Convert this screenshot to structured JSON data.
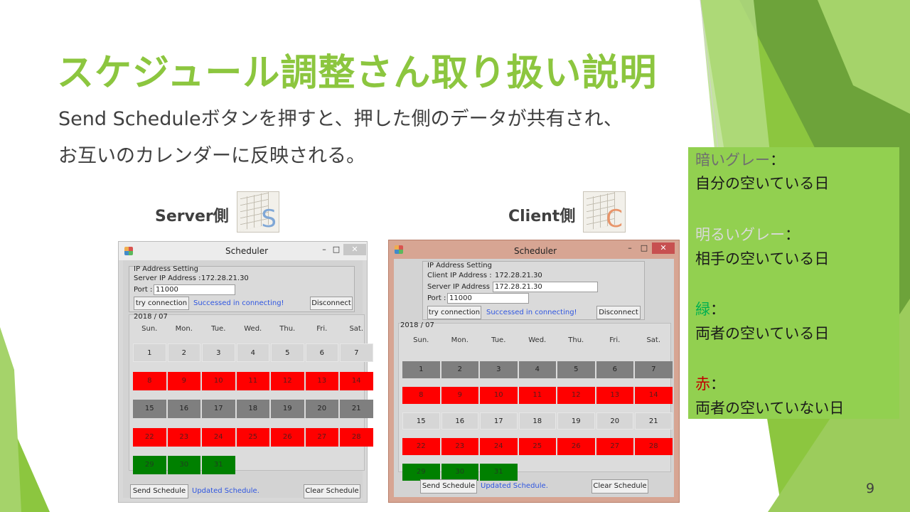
{
  "slide": {
    "title": "スケジュール調整さん取り扱い説明",
    "line1": "Send Scheduleボタンを押すと、押した側のデータが共有され、",
    "line2": "お互いのカレンダーに反映される。",
    "server_label": "Server側",
    "client_label": "Client側",
    "server_icon_letter": "S",
    "client_icon_letter": "C",
    "page_number": "9",
    "colors": {
      "accent": "#8cc63f",
      "legend_bg": "#92d050"
    }
  },
  "legend": [
    {
      "term": "暗いグレー",
      "term_color": "#7f7f7f",
      "sep": "：",
      "desc": "自分の空いている日"
    },
    {
      "term": "明るいグレー",
      "term_color": "#d9d9d9",
      "sep": "：",
      "desc": "相手の空いている日"
    },
    {
      "term": "緑",
      "term_color": "#00b050",
      "sep": "：",
      "desc": "両者の空いている日"
    },
    {
      "term": "赤",
      "term_color": "#c00000",
      "sep": "：",
      "desc": "両者の空いていない日"
    }
  ],
  "server_window": {
    "title": "Scheduler",
    "min": "–",
    "max": "□",
    "close": "✕",
    "ip_section": "IP Address Setting",
    "server_ip_label": "Server IP Address :",
    "server_ip_value": "172.28.21.30",
    "port_label": "Port :",
    "port_value": "11000",
    "try_button": "try connection",
    "connect_status": "Successed in connecting!",
    "disconnect_button": "Disconnect",
    "month": "2018 / 07",
    "weekdays": [
      "Sun.",
      "Mon.",
      "Tue.",
      "Wed.",
      "Thu.",
      "Fri.",
      "Sat."
    ],
    "weeks": [
      [
        {
          "d": "1",
          "s": "plain"
        },
        {
          "d": "2",
          "s": "plain"
        },
        {
          "d": "3",
          "s": "plain"
        },
        {
          "d": "4",
          "s": "plain"
        },
        {
          "d": "5",
          "s": "plain"
        },
        {
          "d": "6",
          "s": "plain"
        },
        {
          "d": "7",
          "s": "plain"
        }
      ],
      [
        {
          "d": "8",
          "s": "red"
        },
        {
          "d": "9",
          "s": "red"
        },
        {
          "d": "10",
          "s": "red"
        },
        {
          "d": "11",
          "s": "red"
        },
        {
          "d": "12",
          "s": "red"
        },
        {
          "d": "13",
          "s": "red"
        },
        {
          "d": "14",
          "s": "red"
        }
      ],
      [
        {
          "d": "15",
          "s": "gray"
        },
        {
          "d": "16",
          "s": "gray"
        },
        {
          "d": "17",
          "s": "gray"
        },
        {
          "d": "18",
          "s": "gray"
        },
        {
          "d": "19",
          "s": "gray"
        },
        {
          "d": "20",
          "s": "gray"
        },
        {
          "d": "21",
          "s": "gray"
        }
      ],
      [
        {
          "d": "22",
          "s": "red"
        },
        {
          "d": "23",
          "s": "red"
        },
        {
          "d": "24",
          "s": "red"
        },
        {
          "d": "25",
          "s": "red"
        },
        {
          "d": "26",
          "s": "red"
        },
        {
          "d": "27",
          "s": "red"
        },
        {
          "d": "28",
          "s": "red"
        }
      ],
      [
        {
          "d": "29",
          "s": "green"
        },
        {
          "d": "30",
          "s": "green"
        },
        {
          "d": "31",
          "s": "green"
        },
        {
          "d": "",
          "s": "empty"
        },
        {
          "d": "",
          "s": "empty"
        },
        {
          "d": "",
          "s": "empty"
        },
        {
          "d": "",
          "s": "empty"
        }
      ]
    ],
    "send_button": "Send Schedule",
    "send_status": "Updated Schedule.",
    "clear_button": "Clear Schedule"
  },
  "client_window": {
    "title": "Scheduler",
    "min": "–",
    "max": "□",
    "close": "✕",
    "ip_section": "IP Address Setting",
    "client_ip_label": "Client IP Address :",
    "client_ip_value": "172.28.21.30",
    "server_ip_label": "Server IP Address :",
    "server_ip_value": "172.28.21.30",
    "port_label": "Port :",
    "port_value": "11000",
    "try_button": "try connection",
    "connect_status": "Successed in connecting!",
    "disconnect_button": "Disconnect",
    "month": "2018 / 07",
    "weekdays": [
      "Sun.",
      "Mon.",
      "Tue.",
      "Wed.",
      "Thu.",
      "Fri.",
      "Sat."
    ],
    "weeks": [
      [
        {
          "d": "1",
          "s": "gray"
        },
        {
          "d": "2",
          "s": "gray"
        },
        {
          "d": "3",
          "s": "gray"
        },
        {
          "d": "4",
          "s": "gray"
        },
        {
          "d": "5",
          "s": "gray"
        },
        {
          "d": "6",
          "s": "gray"
        },
        {
          "d": "7",
          "s": "gray"
        }
      ],
      [
        {
          "d": "8",
          "s": "red"
        },
        {
          "d": "9",
          "s": "red"
        },
        {
          "d": "10",
          "s": "red"
        },
        {
          "d": "11",
          "s": "red"
        },
        {
          "d": "12",
          "s": "red"
        },
        {
          "d": "13",
          "s": "red"
        },
        {
          "d": "14",
          "s": "red"
        }
      ],
      [
        {
          "d": "15",
          "s": "plain"
        },
        {
          "d": "16",
          "s": "plain"
        },
        {
          "d": "17",
          "s": "plain"
        },
        {
          "d": "18",
          "s": "plain"
        },
        {
          "d": "19",
          "s": "plain"
        },
        {
          "d": "20",
          "s": "plain"
        },
        {
          "d": "21",
          "s": "plain"
        }
      ],
      [
        {
          "d": "22",
          "s": "red"
        },
        {
          "d": "23",
          "s": "red"
        },
        {
          "d": "24",
          "s": "red"
        },
        {
          "d": "25",
          "s": "red"
        },
        {
          "d": "26",
          "s": "red"
        },
        {
          "d": "27",
          "s": "red"
        },
        {
          "d": "28",
          "s": "red"
        }
      ],
      [
        {
          "d": "29",
          "s": "green"
        },
        {
          "d": "30",
          "s": "green"
        },
        {
          "d": "31",
          "s": "green"
        },
        {
          "d": "",
          "s": "empty"
        },
        {
          "d": "",
          "s": "empty"
        },
        {
          "d": "",
          "s": "empty"
        },
        {
          "d": "",
          "s": "empty"
        }
      ]
    ],
    "send_button": "Send Schedule",
    "send_status": "Updated Schedule.",
    "clear_button": "Clear Schedule"
  }
}
